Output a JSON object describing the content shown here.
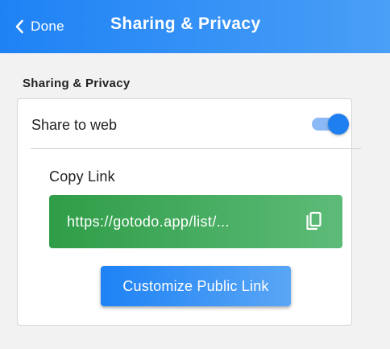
{
  "header": {
    "back_label": "Done",
    "title": "Sharing & Privacy",
    "back_icon": "chevron-left-icon"
  },
  "section": {
    "label": "Sharing & Privacy"
  },
  "share": {
    "label": "Share to web",
    "enabled": true
  },
  "copy_link": {
    "label": "Copy Link",
    "url": "https://gotodo.app/list/...",
    "icon": "copy-icon"
  },
  "customize_button": {
    "label": "Customize Public Link"
  },
  "colors": {
    "header_start": "#1e82f5",
    "header_end": "#4a9ff6",
    "toggle_on": "#1f7ff0",
    "link_box_start": "#2f9d47",
    "link_box_end": "#5dbb78",
    "background": "#f2f2f2"
  }
}
